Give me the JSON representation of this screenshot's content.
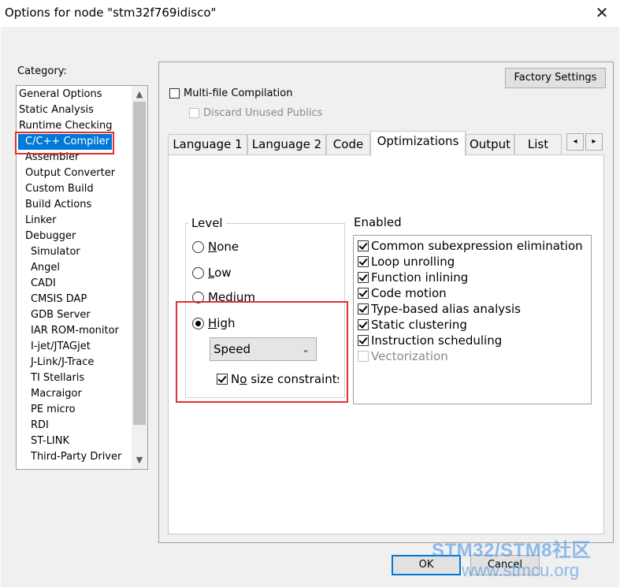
{
  "window": {
    "title": "Options for node \"stm32f769idisco\"",
    "close_glyph": "✕"
  },
  "category": {
    "label": "Category:",
    "items": [
      "General Options",
      "Static Analysis",
      "Runtime Checking",
      "C/C++ Compiler",
      "Assembler",
      "Output Converter",
      "Custom Build",
      "Build Actions",
      "Linker",
      "Debugger",
      "Simulator",
      "Angel",
      "CADI",
      "CMSIS DAP",
      "GDB Server",
      "IAR ROM-monitor",
      "I-jet/JTAGjet",
      "J-Link/J-Trace",
      "TI Stellaris",
      "Macraigor",
      "PE micro",
      "RDI",
      "ST-LINK",
      "Third-Party Driver"
    ],
    "selected": "C/C++ Compiler"
  },
  "factory_settings_label": "Factory Settings",
  "multifile": {
    "label": "Multi-file Compilation",
    "checked": false
  },
  "discard": {
    "label": "Discard Unused Publics",
    "checked": false,
    "enabled": false
  },
  "tabs": [
    "Language 1",
    "Language 2",
    "Code",
    "Optimizations",
    "Output",
    "List"
  ],
  "active_tab": "Optimizations",
  "tab_scroll": {
    "left": "◂",
    "right": "▸"
  },
  "level": {
    "label": "Level",
    "options": [
      {
        "key": "N",
        "rest": "one",
        "checked": false
      },
      {
        "key": "L",
        "rest": "ow",
        "checked": false
      },
      {
        "key": "M",
        "rest": "edium",
        "checked": false
      },
      {
        "key": "H",
        "rest": "igh",
        "checked": true
      }
    ],
    "goal_value": "Speed",
    "no_size": {
      "pre": "N",
      "key": "o",
      "rest": " size constraints",
      "checked": true
    }
  },
  "enabled": {
    "label": "Enabled",
    "items": [
      {
        "label": "Common subexpression elimination",
        "checked": true,
        "enabled": true
      },
      {
        "label": "Loop unrolling",
        "checked": true,
        "enabled": true
      },
      {
        "label": "Function inlining",
        "checked": true,
        "enabled": true
      },
      {
        "label": "Code motion",
        "checked": true,
        "enabled": true
      },
      {
        "label": "Type-based alias analysis",
        "checked": true,
        "enabled": true
      },
      {
        "label": "Static clustering",
        "checked": true,
        "enabled": true
      },
      {
        "label": "Instruction scheduling",
        "checked": true,
        "enabled": true
      },
      {
        "label": "Vectorization",
        "checked": false,
        "enabled": false
      }
    ]
  },
  "buttons": {
    "ok": "OK",
    "cancel": "Cancel"
  },
  "watermark": {
    "line1": "STM32/STM8社区",
    "line2": "www.stmcu.org"
  },
  "colors": {
    "selection": "#0078d7",
    "highlight": "#e03030"
  }
}
